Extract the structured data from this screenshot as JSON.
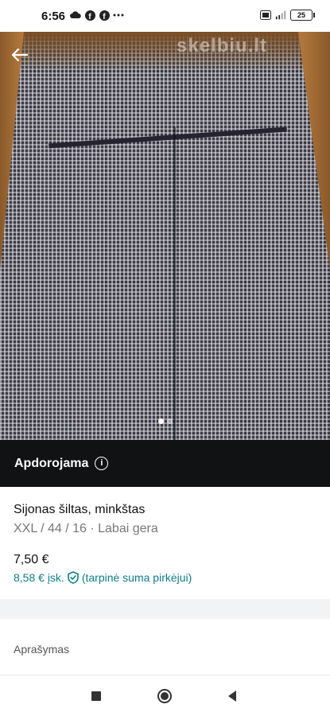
{
  "status_bar": {
    "time": "6:56",
    "left_icons": [
      "cloud-icon",
      "facebook-icon",
      "facebook-icon",
      "more-dots-icon"
    ],
    "right_icons": [
      "volte-icon",
      "signal-icon"
    ],
    "battery": "25"
  },
  "gallery": {
    "watermark": "skelbiu.lt",
    "dots_count": 2,
    "active_dot": 0
  },
  "status_banner": {
    "label": "Apdorojama",
    "info_glyph": "i"
  },
  "item": {
    "title": "Sijonas šiltas, minkštas",
    "meta": "XXL / 44 / 16 · Labai gera",
    "price": "7,50 €",
    "price_incl": "8,58 € įsk.",
    "price_note": "(tarpinė suma pirkėjui)"
  },
  "description": {
    "label": "Aprašymas"
  },
  "colors": {
    "accent": "#0e7d8a",
    "banner_bg": "#111214"
  }
}
